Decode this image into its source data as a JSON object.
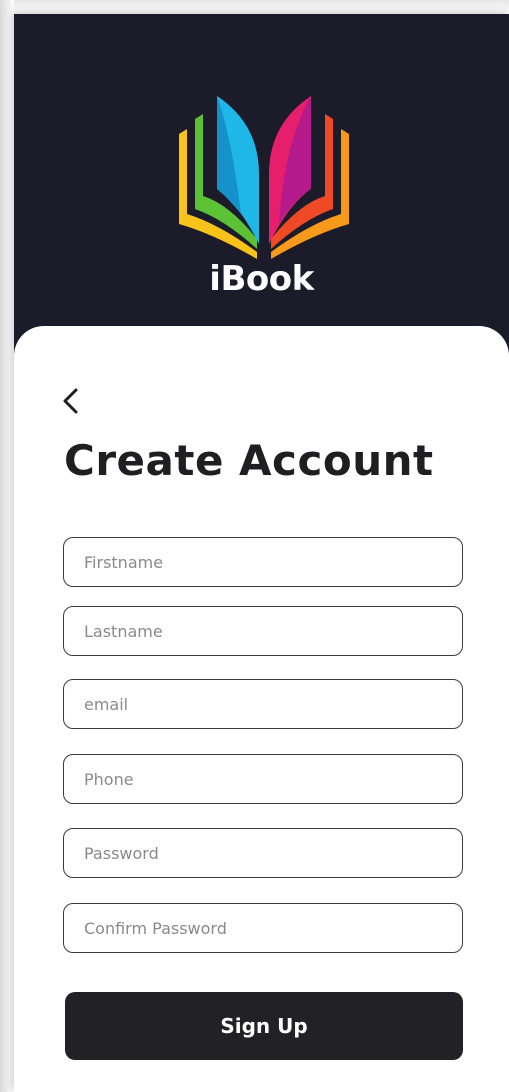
{
  "app": {
    "brand_name": "iBook",
    "colors": {
      "header_bg": "#1c1b2a",
      "button_bg": "#222226",
      "text_dark": "#1f1f22"
    }
  },
  "icons": {
    "logo": "book-logo-icon",
    "back": "chevron-left-icon"
  },
  "form": {
    "title": "Create Account",
    "fields": [
      {
        "placeholder": "Firstname",
        "value": ""
      },
      {
        "placeholder": "Lastname",
        "value": ""
      },
      {
        "placeholder": "email",
        "value": ""
      },
      {
        "placeholder": "Phone",
        "value": ""
      },
      {
        "placeholder": "Password",
        "value": ""
      },
      {
        "placeholder": "Confirm Password",
        "value": ""
      }
    ],
    "submit_label": "Sign Up"
  }
}
